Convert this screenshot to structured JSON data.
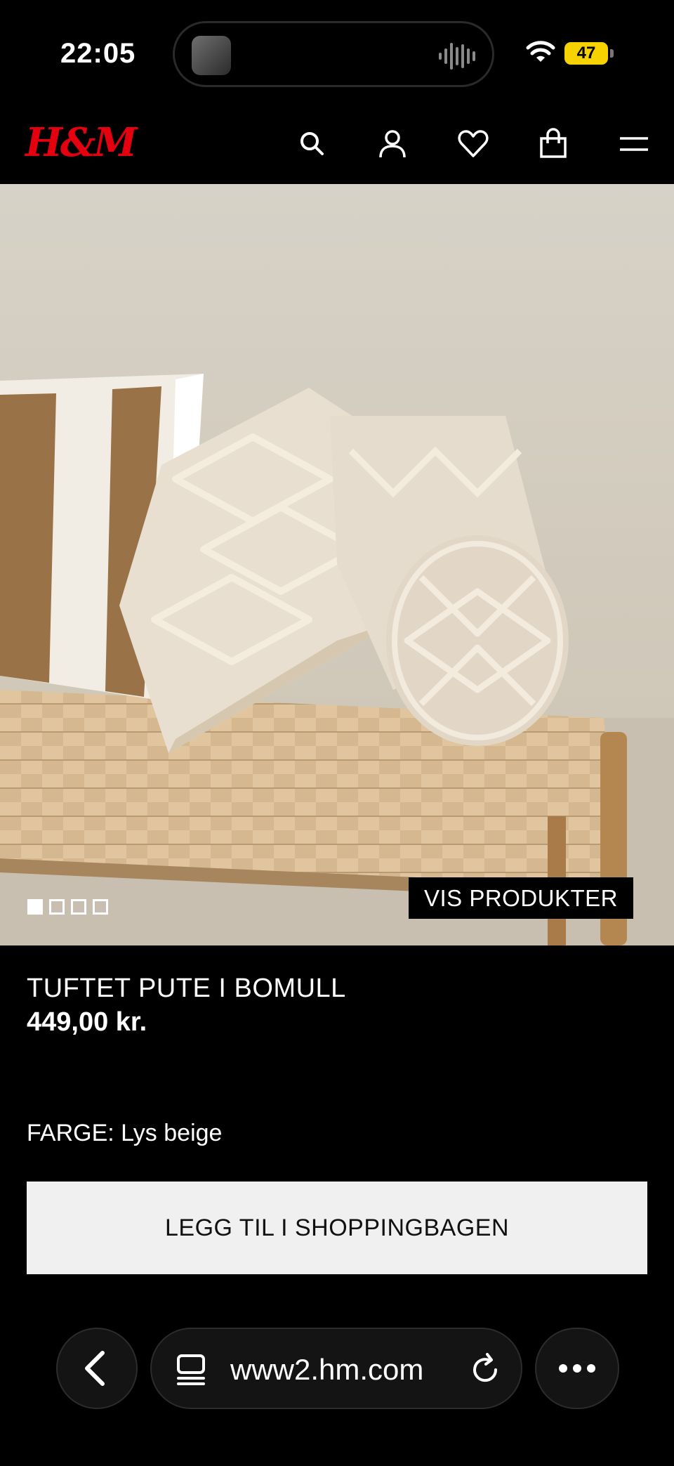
{
  "status_bar": {
    "time": "22:05",
    "battery": "47"
  },
  "header": {
    "logo": "H&M",
    "icons": [
      "search-icon",
      "account-icon",
      "heart-icon",
      "bag-icon",
      "menu-icon"
    ]
  },
  "gallery": {
    "image_count": 4,
    "active_index": 0,
    "show_products_label": "VIS PRODUKTER"
  },
  "product": {
    "name": "TUFTET PUTE I BOMULL",
    "price": "449,00 kr.",
    "color_label": "FARGE:",
    "color_value": "Lys beige",
    "add_to_bag_label": "LEGG TIL I SHOPPINGBAGEN"
  },
  "browser": {
    "url": "www2.hm.com"
  },
  "colors": {
    "brand_red": "#e50010",
    "background": "#000000",
    "button_bg": "#f0f0f0"
  }
}
